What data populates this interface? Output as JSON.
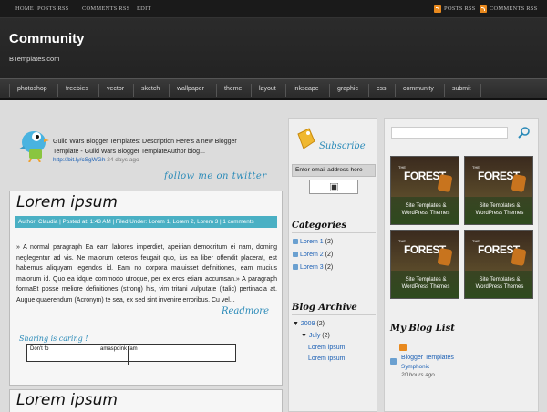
{
  "topbar": {
    "links": [
      "HOME",
      "POSTS RSS",
      "COMMENTS RSS",
      "EDIT"
    ],
    "rss_posts": "POSTS RSS",
    "rss_comments": "COMMENTS RSS"
  },
  "header": {
    "title": "Community",
    "subtitle": "BTemplates.com"
  },
  "nav": {
    "items": [
      "photoshop",
      "freebies",
      "vector",
      "sketch",
      "wallpaper",
      "theme",
      "layout",
      "inkscape",
      "graphic",
      "css",
      "community",
      "submit"
    ]
  },
  "twitter": {
    "text": "Guild Wars Blogger Templates: Description Here's a new Blogger Template - Guild Wars Blogger TemplateAuthor blog...",
    "link": "http://bit.ly/cSgWGh",
    "time": "24 days ago",
    "follow": "follow me on twitter"
  },
  "post1": {
    "title": "Lorem ipsum",
    "meta": "Author: Claudia | Posted at: 1:43 AM | Filed Under: Lorem 1, Lorem 2, Lorem 3 | 1 comments",
    "body": "» A normal paragraph Ea eam labores imperdiet, apeirian democritum ei nam, doming neglegentur ad vis. Ne malorum ceteros feugait quo, ius ea liber offendit placerat, est habemus aliquyam legendos id. Eam no corpora maluisset definitiones, eam mucius malorum id. Quo ea idque commodo utroque, per ex eros etiam accumsan.» A paragraph formaEt posse meliore definitiones (strong) his, vim tritani vulputate (italic) pertinacia at. Augue quaerendum (Acronym) te sea, ex sed sint invenire erroribus. Cu vel...",
    "readmore": "Readmore",
    "sharing": "Sharing is caring !",
    "share_left": "Don't fo",
    "share_right": "amaspdink fam"
  },
  "post2": {
    "title": "Lorem ipsum"
  },
  "subscribe": {
    "label": "Subscribe",
    "email_placeholder": "Enter email address here"
  },
  "categories": {
    "title": "Categories",
    "items": [
      {
        "label": "Lorem 1",
        "count": "(2)"
      },
      {
        "label": "Lorem 2",
        "count": "(2)"
      },
      {
        "label": "Lorem 3",
        "count": "(2)"
      }
    ]
  },
  "archive": {
    "title": "Blog Archive",
    "year": "2009",
    "year_count": "(2)",
    "month": "July",
    "month_count": "(2)",
    "posts": [
      "Lorem ipsum",
      "Lorem ipsum"
    ]
  },
  "ads": {
    "items": [
      {
        "the": "THE",
        "brand": "FOREST",
        "line1": "Site Templates &",
        "line2": "WordPress Themes"
      },
      {
        "the": "THE",
        "brand": "FOREST",
        "line1": "Site Templates &",
        "line2": "WordPress Themes"
      },
      {
        "the": "THE",
        "brand": "FOREST",
        "line1": "Site Templates &",
        "line2": "WordPress Themes"
      },
      {
        "the": "THE",
        "brand": "FOREST",
        "line1": "Site Templates &",
        "line2": "WordPress Themes"
      }
    ]
  },
  "blog_list": {
    "title": "My Blog List",
    "name": "Blogger Templates",
    "sub": "Symphonic",
    "time": "20 hours ago"
  },
  "colors": {
    "accent": "#4ab0c4",
    "link": "#1a5fb4",
    "rss": "#e8891e"
  }
}
